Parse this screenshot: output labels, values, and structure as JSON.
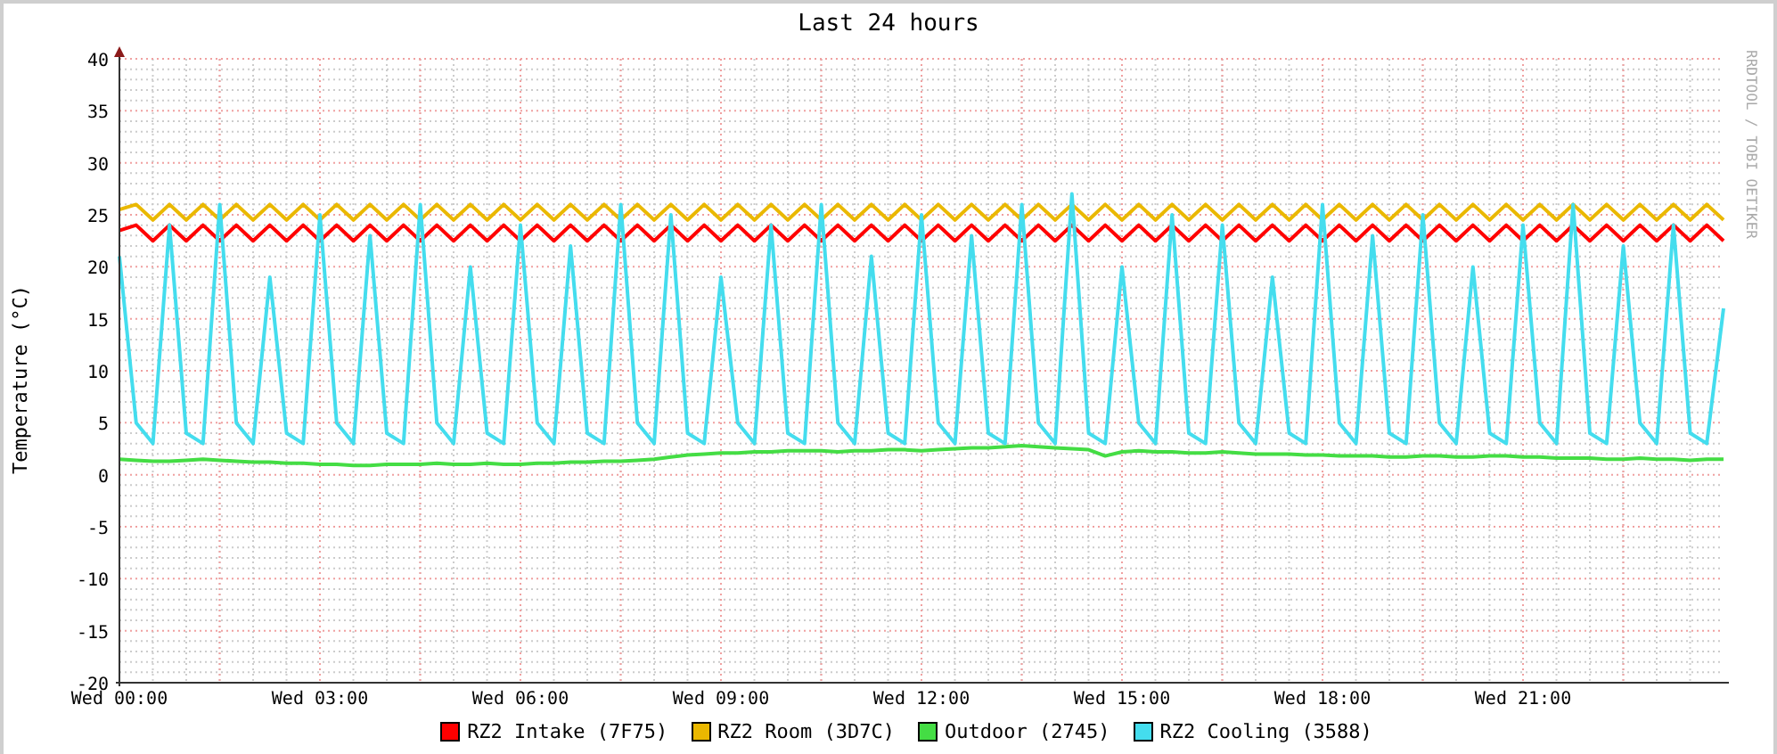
{
  "credit": "RRDTOOL / TOBI OETIKER",
  "chart_data": {
    "type": "line",
    "title": "Last 24 hours",
    "ylabel": "Temperature (°C)",
    "categories": [
      "Wed 00:00",
      null,
      null,
      null,
      null,
      null,
      null,
      null,
      null,
      null,
      null,
      null,
      "Wed 03:00",
      null,
      null,
      null,
      null,
      null,
      null,
      null,
      null,
      null,
      null,
      null,
      "Wed 06:00",
      null,
      null,
      null,
      null,
      null,
      null,
      null,
      null,
      null,
      null,
      null,
      "Wed 09:00",
      null,
      null,
      null,
      null,
      null,
      null,
      null,
      null,
      null,
      null,
      null,
      "Wed 12:00",
      null,
      null,
      null,
      null,
      null,
      null,
      null,
      null,
      null,
      null,
      null,
      "Wed 15:00",
      null,
      null,
      null,
      null,
      null,
      null,
      null,
      null,
      null,
      null,
      null,
      "Wed 18:00",
      null,
      null,
      null,
      null,
      null,
      null,
      null,
      null,
      null,
      null,
      null,
      "Wed 21:00",
      null,
      null,
      null,
      null,
      null,
      null,
      null,
      null,
      null,
      null,
      null,
      null
    ],
    "grid": true,
    "ylim": [
      -20,
      40
    ],
    "yticks": [
      -20,
      -15,
      -10,
      -5,
      0,
      5,
      10,
      15,
      20,
      25,
      30,
      35,
      40
    ],
    "series": [
      {
        "name": "RZ2 Intake (7F75)",
        "color": "#ff0000",
        "values": [
          23.5,
          24,
          22.5,
          24,
          22.5,
          24,
          22.5,
          24,
          22.5,
          24,
          22.5,
          24,
          22.5,
          24,
          22.5,
          24,
          22.5,
          24,
          22.5,
          24,
          22.5,
          24,
          22.5,
          24,
          22.5,
          24,
          22.5,
          24,
          22.5,
          24,
          22.5,
          24,
          22.5,
          24,
          22.5,
          24,
          22.5,
          24,
          22.5,
          24,
          22.5,
          24,
          22.5,
          24,
          22.5,
          24,
          22.5,
          24,
          22.5,
          24,
          22.5,
          24,
          22.5,
          24,
          22.5,
          24,
          22.5,
          24,
          22.5,
          24,
          22.5,
          24,
          22.5,
          24,
          22.5,
          24,
          22.5,
          24,
          22.5,
          24,
          22.5,
          24,
          22.5,
          24,
          22.5,
          24,
          22.5,
          24,
          22.5,
          24,
          22.5,
          24,
          22.5,
          24,
          22.5,
          24,
          22.5,
          24,
          22.5,
          24,
          22.5,
          24,
          22.5,
          24,
          22.5,
          24,
          22.5
        ]
      },
      {
        "name": "RZ2 Room (3D7C)",
        "color": "#eab800",
        "values": [
          25.5,
          26,
          24.5,
          26,
          24.5,
          26,
          24.5,
          26,
          24.5,
          26,
          24.5,
          26,
          24.5,
          26,
          24.5,
          26,
          24.5,
          26,
          24.5,
          26,
          24.5,
          26,
          24.5,
          26,
          24.5,
          26,
          24.5,
          26,
          24.5,
          26,
          24.5,
          26,
          24.5,
          26,
          24.5,
          26,
          24.5,
          26,
          24.5,
          26,
          24.5,
          26,
          24.5,
          26,
          24.5,
          26,
          24.5,
          26,
          24.5,
          26,
          24.5,
          26,
          24.5,
          26,
          24.5,
          26,
          24.5,
          26,
          24.5,
          26,
          24.5,
          26,
          24.5,
          26,
          24.5,
          26,
          24.5,
          26,
          24.5,
          26,
          24.5,
          26,
          24.5,
          26,
          24.5,
          26,
          24.5,
          26,
          24.5,
          26,
          24.5,
          26,
          24.5,
          26,
          24.5,
          26,
          24.5,
          26,
          24.5,
          26,
          24.5,
          26,
          24.5,
          26,
          24.5,
          26,
          24.5
        ]
      },
      {
        "name": "Outdoor (2745)",
        "color": "#44dd44",
        "values": [
          1.5,
          1.4,
          1.3,
          1.3,
          1.4,
          1.5,
          1.4,
          1.3,
          1.2,
          1.2,
          1.1,
          1.1,
          1.0,
          1.0,
          0.9,
          0.9,
          1.0,
          1.0,
          1.0,
          1.1,
          1.0,
          1.0,
          1.1,
          1.0,
          1.0,
          1.1,
          1.1,
          1.2,
          1.2,
          1.3,
          1.3,
          1.4,
          1.5,
          1.7,
          1.9,
          2.0,
          2.1,
          2.1,
          2.2,
          2.2,
          2.3,
          2.3,
          2.3,
          2.2,
          2.3,
          2.3,
          2.4,
          2.4,
          2.3,
          2.4,
          2.5,
          2.6,
          2.6,
          2.7,
          2.8,
          2.7,
          2.6,
          2.5,
          2.4,
          1.8,
          2.2,
          2.3,
          2.2,
          2.2,
          2.1,
          2.1,
          2.2,
          2.1,
          2.0,
          2.0,
          2.0,
          1.9,
          1.9,
          1.8,
          1.8,
          1.8,
          1.7,
          1.7,
          1.8,
          1.8,
          1.7,
          1.7,
          1.8,
          1.8,
          1.7,
          1.7,
          1.6,
          1.6,
          1.6,
          1.5,
          1.5,
          1.6,
          1.5,
          1.5,
          1.4,
          1.5,
          1.5
        ]
      },
      {
        "name": "RZ2 Cooling (3588)",
        "color": "#44ddee",
        "values": [
          21,
          5,
          3,
          24,
          4,
          3,
          26,
          5,
          3,
          19,
          4,
          3,
          25,
          5,
          3,
          23,
          4,
          3,
          26,
          5,
          3,
          20,
          4,
          3,
          24,
          5,
          3,
          22,
          4,
          3,
          26,
          5,
          3,
          25,
          4,
          3,
          19,
          5,
          3,
          24,
          4,
          3,
          26,
          5,
          3,
          21,
          4,
          3,
          25,
          5,
          3,
          23,
          4,
          3,
          26,
          5,
          3,
          27,
          4,
          3,
          20,
          5,
          3,
          25,
          4,
          3,
          24,
          5,
          3,
          19,
          4,
          3,
          26,
          5,
          3,
          23,
          4,
          3,
          25,
          5,
          3,
          20,
          4,
          3,
          24,
          5,
          3,
          26,
          4,
          3,
          22,
          5,
          3,
          24,
          4,
          3,
          16
        ]
      }
    ]
  }
}
